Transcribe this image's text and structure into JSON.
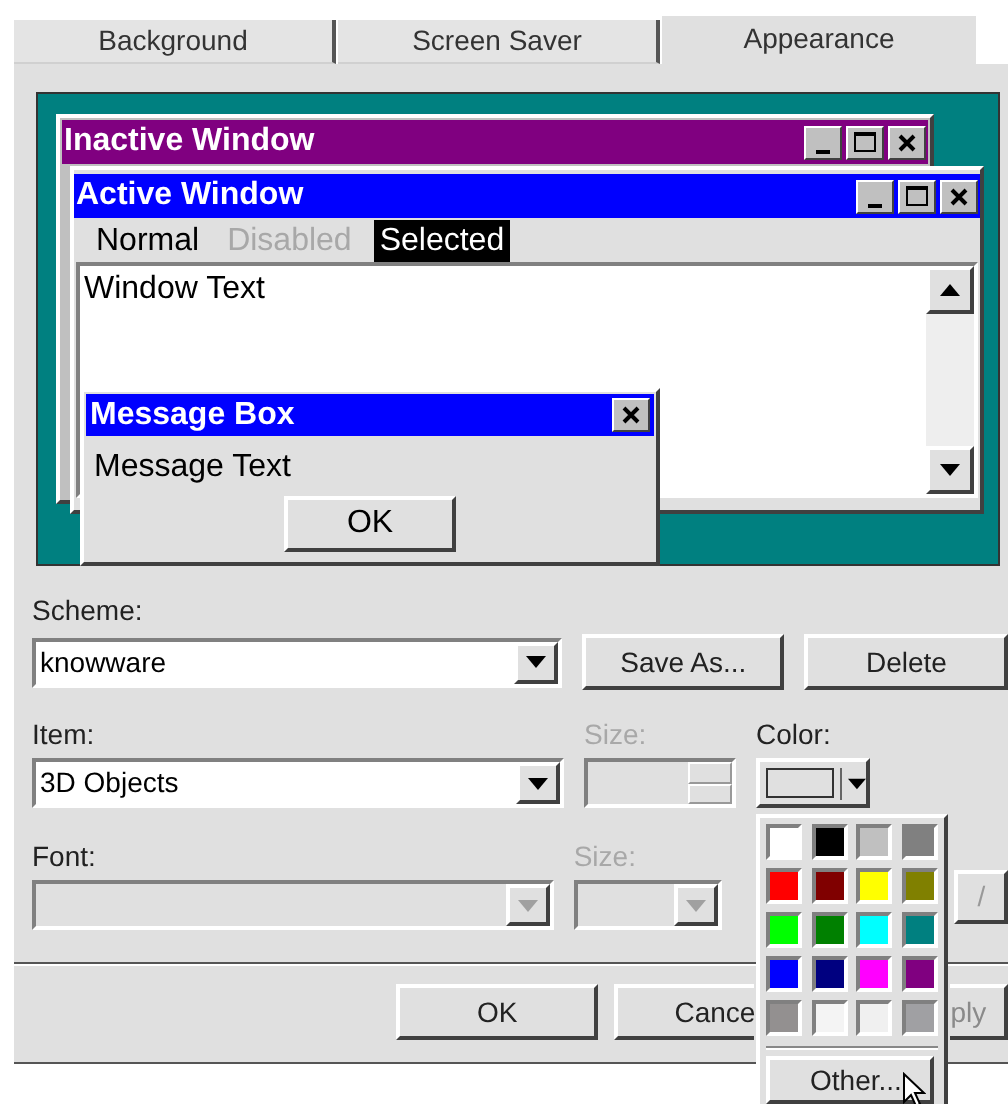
{
  "tabs": [
    {
      "label": "Background",
      "selected": false
    },
    {
      "label": "Screen Saver",
      "selected": false
    },
    {
      "label": "Appearance",
      "selected": true
    }
  ],
  "preview": {
    "inactive_window": {
      "title": "Inactive Window"
    },
    "active_window": {
      "title": "Active Window",
      "menu": [
        {
          "label": "Normal",
          "kind": "normal"
        },
        {
          "label": "Disabled",
          "kind": "disabled"
        },
        {
          "label": "Selected",
          "kind": "selected"
        }
      ],
      "window_text": "Window Text"
    },
    "message_box": {
      "title": "Message Box",
      "text": "Message Text",
      "button": "OK"
    }
  },
  "scheme": {
    "label": "Scheme:",
    "value": "knowware",
    "buttons": [
      {
        "label": "Save As..."
      },
      {
        "label": "Delete"
      }
    ]
  },
  "item": {
    "label": "Item:",
    "value": "3D Objects",
    "size": {
      "label": "Size:",
      "disabled": true
    },
    "color": {
      "label": "Color:"
    }
  },
  "font": {
    "label": "Font:",
    "disabled": true,
    "size": {
      "label": "Size:",
      "disabled": true
    },
    "side_button": {
      "label": "/"
    }
  },
  "color_menu": {
    "swatches": [
      {
        "color": "#ffffff"
      },
      {
        "color": "#000000"
      },
      {
        "color": "#c0c0c0"
      },
      {
        "color": "#808080"
      },
      {
        "color": "#ff0000"
      },
      {
        "color": "#800000"
      },
      {
        "color": "#ffff00"
      },
      {
        "color": "#808000"
      },
      {
        "color": "#00ff00"
      },
      {
        "color": "#008000"
      },
      {
        "color": "#00ffff"
      },
      {
        "color": "#008080"
      },
      {
        "color": "#0000ff"
      },
      {
        "color": "#000080"
      },
      {
        "color": "#ff00ff"
      },
      {
        "color": "#800080"
      },
      {
        "color": "#939090"
      },
      {
        "color": "#f4f4f4"
      },
      {
        "color": "#f0f0f0"
      },
      {
        "color": "#a0a0a3"
      }
    ],
    "other_button": {
      "label": "Other..."
    }
  },
  "buttons": [
    {
      "label": "OK"
    },
    {
      "label": "Cance"
    },
    {
      "label": "ply"
    }
  ]
}
